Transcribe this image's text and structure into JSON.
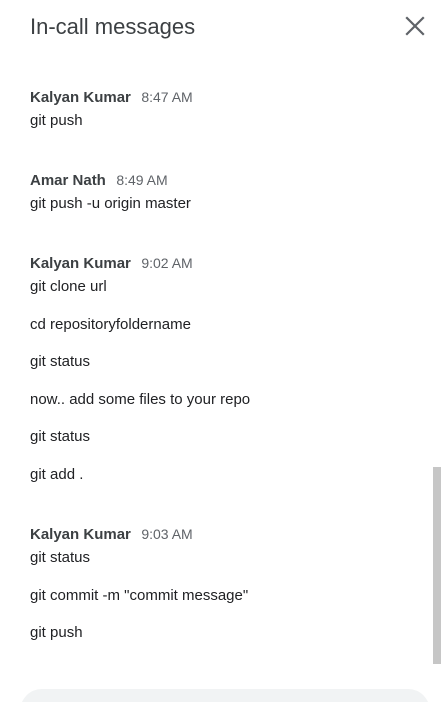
{
  "header": {
    "title": "In-call messages",
    "close_icon": "close-icon"
  },
  "messages": [
    {
      "sender": "Kalyan Kumar",
      "time": "8:47 AM",
      "lines": [
        "git push"
      ]
    },
    {
      "sender": "Amar Nath",
      "time": "8:49 AM",
      "lines": [
        "git push -u origin master"
      ]
    },
    {
      "sender": "Kalyan Kumar",
      "time": "9:02 AM",
      "lines": [
        "git clone url",
        "cd repositoryfoldername",
        "git status",
        "now.. add some files to your repo",
        "git status",
        "git add ."
      ]
    },
    {
      "sender": "Kalyan Kumar",
      "time": "9:03 AM",
      "lines": [
        "git status",
        "git commit -m \"commit message\"",
        "git push"
      ]
    }
  ],
  "colors": {
    "title": "#3c4043",
    "sender": "#3c4043",
    "time": "#5f6368",
    "text": "#202124",
    "scrollbar": "#c6c6c6",
    "compose_bg": "#f1f3f4"
  }
}
